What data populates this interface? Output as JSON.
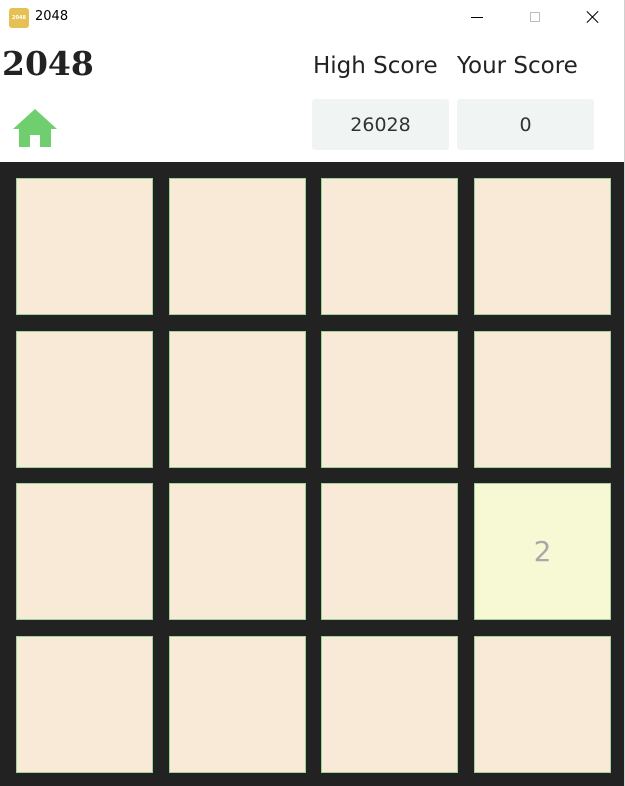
{
  "window": {
    "title": "2048",
    "icon_text": "2048",
    "icon": "app-2048-icon",
    "icon_color": "#e6c052",
    "controls": [
      "minimize-icon",
      "maximize-icon",
      "close-icon"
    ]
  },
  "header": {
    "title": "2048",
    "home_icon": "home-icon",
    "home_color": "#6fcf6f",
    "high_score_label": "High Score",
    "your_score_label": "Your Score",
    "high_score": "26028",
    "your_score": "0"
  },
  "board": {
    "size": 4,
    "background": "#222222",
    "empty_tile_color": "#f9ead8",
    "tile_2_color": "#f7f9d4",
    "tile_border_color": "#9bd39b",
    "cells": [
      [
        "",
        "",
        "",
        ""
      ],
      [
        "",
        "",
        "",
        ""
      ],
      [
        "",
        "",
        "",
        "2"
      ],
      [
        "",
        "",
        "",
        ""
      ]
    ]
  }
}
